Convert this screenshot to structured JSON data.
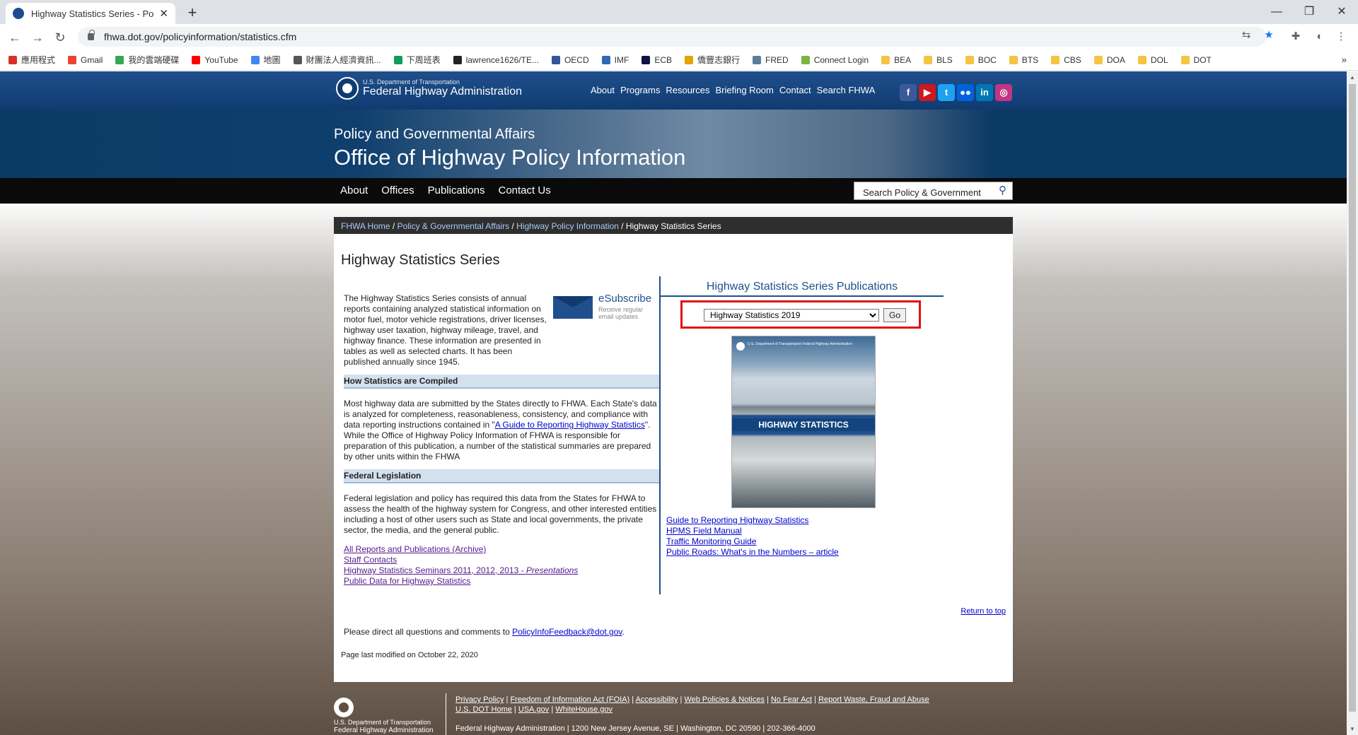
{
  "browser": {
    "tab_title": "Highway Statistics Series - Polic",
    "url": "fhwa.dot.gov/policyinformation/statistics.cfm",
    "bookmarks": [
      {
        "label": "應用程式",
        "color": "#d93025"
      },
      {
        "label": "Gmail",
        "color": "#ea4335"
      },
      {
        "label": "我的雲端硬碟",
        "color": "#34a853"
      },
      {
        "label": "YouTube",
        "color": "#ff0000"
      },
      {
        "label": "地圖",
        "color": "#4285f4"
      },
      {
        "label": "財團法人經濟資訊...",
        "color": "#555555"
      },
      {
        "label": "下周班表",
        "color": "#0f9d58"
      },
      {
        "label": "lawrence1626/TE...",
        "color": "#222222"
      },
      {
        "label": "OECD",
        "color": "#335599"
      },
      {
        "label": "IMF",
        "color": "#2e6ab2"
      },
      {
        "label": "ECB",
        "color": "#111144"
      },
      {
        "label": "僑豐志銀行",
        "color": "#e2a400"
      },
      {
        "label": "FRED",
        "color": "#5a7d9a"
      },
      {
        "label": "Connect Login",
        "color": "#7cb342"
      },
      {
        "label": "BEA",
        "color": "#f4c542"
      },
      {
        "label": "BLS",
        "color": "#f4c542"
      },
      {
        "label": "BOC",
        "color": "#f4c542"
      },
      {
        "label": "BTS",
        "color": "#f4c542"
      },
      {
        "label": "CBS",
        "color": "#f4c542"
      },
      {
        "label": "DOA",
        "color": "#f4c542"
      },
      {
        "label": "DOL",
        "color": "#f4c542"
      },
      {
        "label": "DOT",
        "color": "#f4c542"
      }
    ],
    "more": "»"
  },
  "header": {
    "dept": "U.S. Department of Transportation",
    "agency": "Federal Highway Administration",
    "menu": [
      "About",
      "Programs",
      "Resources",
      "Briefing Room",
      "Contact",
      "Search FHWA"
    ],
    "social": [
      {
        "icon": "facebook-icon",
        "glyph": "f",
        "color": "#3b5998"
      },
      {
        "icon": "youtube-icon",
        "glyph": "▶",
        "color": "#cc181e"
      },
      {
        "icon": "twitter-icon",
        "glyph": "t",
        "color": "#1da1f2"
      },
      {
        "icon": "flickr-icon",
        "glyph": "●●",
        "color": "#0063dc"
      },
      {
        "icon": "linkedin-icon",
        "glyph": "in",
        "color": "#0077b5"
      },
      {
        "icon": "instagram-icon",
        "glyph": "◎",
        "color": "#c13584"
      }
    ]
  },
  "banner": {
    "subtitle": "Policy and Governmental Affairs",
    "title": "Office of Highway Policy Information"
  },
  "subnav": {
    "items": [
      "About",
      "Offices",
      "Publications",
      "Contact Us"
    ],
    "search_placeholder": "Search Policy & Government"
  },
  "breadcrumb": {
    "links": [
      "FHWA Home",
      "Policy & Governmental Affairs",
      "Highway Policy Information"
    ],
    "separator": " / ",
    "current": "Highway Statistics Series"
  },
  "page": {
    "title": "Highway Statistics Series",
    "intro": "The Highway Statistics Series consists of annual reports containing analyzed statistical information on motor fuel, motor vehicle registrations, driver licenses, highway user taxation, highway mileage, travel, and highway finance. These information are presented in tables as well as selected charts. It has been published annually since 1945.",
    "esubscribe": {
      "label": "eSubscribe",
      "sub": "Receive regular email updates"
    },
    "sections": [
      {
        "heading": "How Statistics are Compiled",
        "text_before": "Most highway data are submitted by the States directly to FHWA. Each State's data is analyzed for completeness, reasonableness, consistency, and compliance with data reporting instructions contained in \"",
        "link": "A Guide to Reporting Highway Statistics",
        "text_after": "\". While the Office of Highway Policy Information of FHWA is responsible for preparation of this publication, a number of the statistical summaries are prepared by other units within the FHWA"
      },
      {
        "heading": "Federal Legislation",
        "text": "Federal legislation and policy has required this data from the States for FHWA to assess the health of the highway system for Congress, and other interested entities including a host of other users such as State and local governments, the private sector, the media, and the general public."
      }
    ],
    "links": [
      {
        "text": "All Reports and Publications (Archive)"
      },
      {
        "text": "Staff Contacts"
      },
      {
        "text": "Highway Statistics Seminars 2011, 2012, 2013 - ",
        "italic": "Presentations"
      },
      {
        "text": "Public Data for Highway Statistics"
      }
    ],
    "publications": {
      "title": "Highway Statistics Series Publications",
      "selected": "Highway Statistics 2019",
      "go": "Go",
      "cover_band": "HIGHWAY STATISTICS",
      "cover_dept": "U.S. Department of Transportation Federal Highway Administration",
      "links": [
        "Guide to Reporting Highway Statistics",
        "HPMS Field Manual",
        "Traffic Monitoring Guide",
        "Public Roads: What's in the Numbers – article"
      ]
    },
    "return_top": "Return to top",
    "direct_text": "Please direct all questions and comments to ",
    "direct_email": "PolicyInfoFeedback@dot.gov",
    "direct_end": ".",
    "modified": "Page last modified on October 22, 2020"
  },
  "footer": {
    "dept": "U.S. Department of Transportation",
    "agency": "Federal Highway Administration",
    "links_row1": [
      "Privacy Policy",
      "Freedom of Information Act (FOIA)",
      "Accessibility",
      "Web Policies & Notices",
      "No Fear Act",
      "Report Waste, Fraud and Abuse"
    ],
    "links_row2": [
      "U.S. DOT Home",
      "USA.gov",
      "WhiteHouse.gov"
    ],
    "address": "Federal Highway Administration | 1200 New Jersey Avenue, SE | Washington, DC 20590 | 202-366-4000"
  }
}
